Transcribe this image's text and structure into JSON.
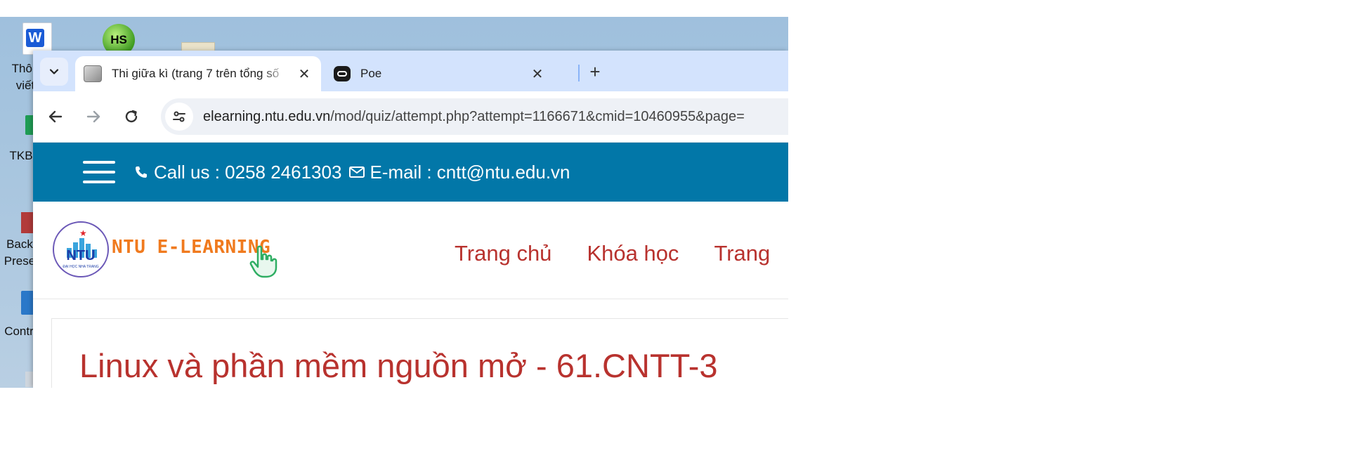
{
  "desktop": {
    "icons": [
      {
        "name": "word-doc",
        "label_line1": "Thôn",
        "label_line2": "viết"
      },
      {
        "name": "hs",
        "glyph": "HS"
      },
      {
        "name": "tkb",
        "label": "TKB"
      },
      {
        "name": "backup",
        "label_line1": "Back",
        "label_line2": "Prese"
      },
      {
        "name": "control",
        "label": "Contr"
      }
    ]
  },
  "browser": {
    "tabs": [
      {
        "title": "Thi giữa kì (trang 7 trên tổng số",
        "close_glyph": "✕",
        "active": true
      },
      {
        "title": "Poe",
        "close_glyph": "✕",
        "active": false
      }
    ],
    "new_tab_glyph": "+",
    "url_host": "elearning.ntu.edu.vn",
    "url_path": "/mod/quiz/attempt.php?attempt=1166671&cmid=10460955&page="
  },
  "site": {
    "topbar": {
      "call_text": "Call us : 0258 2461303",
      "email_text": "E-mail : cntt@ntu.edu.vn"
    },
    "logo": {
      "abbr": "NTU",
      "brand": "NTU E-LEARNING",
      "small_text": "ĐẠI HỌC NHA TRANG"
    },
    "menu": [
      "Trang chủ",
      "Khóa học",
      "Trang"
    ],
    "course_title": "Linux và phần mềm nguồn mở - 61.CNTT-3"
  },
  "colors": {
    "topbar_bg": "#0277a8",
    "menu_text": "#b8322e",
    "brand_orange": "#f07a1e",
    "tabstrip_bg": "#d3e3fd"
  }
}
